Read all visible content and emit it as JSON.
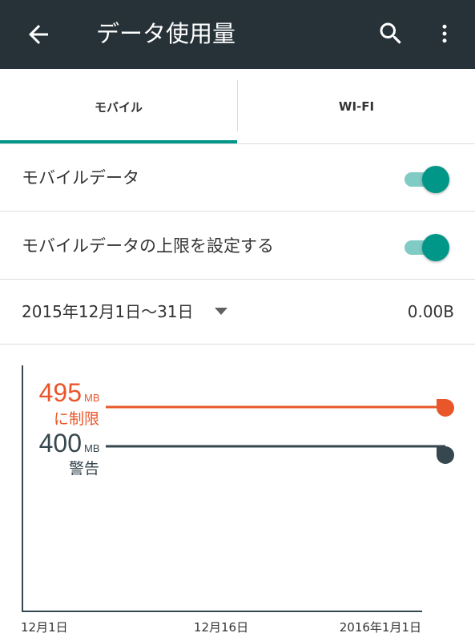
{
  "appbar": {
    "title": "データ使用量",
    "back_icon": "arrow-back-icon",
    "search_icon": "search-icon",
    "more_icon": "more-vert-icon"
  },
  "tabs": [
    {
      "label": "モバイル",
      "selected": true
    },
    {
      "label": "WI-FI",
      "selected": false
    }
  ],
  "settings": {
    "mobile_data": {
      "label": "モバイルデータ",
      "on": true
    },
    "limit": {
      "label": "モバイルデータの上限を設定する",
      "on": true
    }
  },
  "cycle": {
    "range": "2015年12月1日〜31日",
    "amount": "0.00B"
  },
  "chart_data": {
    "type": "line",
    "x_labels": [
      "12月1日",
      "12月16日",
      "2016年1月1日"
    ],
    "thresholds": [
      {
        "value": "495",
        "unit": "MB",
        "caption": "に制限",
        "mb": 495,
        "color": "#e8562a"
      },
      {
        "value": "400",
        "unit": "MB",
        "caption": "警告",
        "mb": 400,
        "color": "#37474f"
      }
    ],
    "usage_mb": 0
  },
  "colors": {
    "appbar": "#263238",
    "accent": "#009688",
    "limit": "#e8562a",
    "warning": "#37474f"
  }
}
